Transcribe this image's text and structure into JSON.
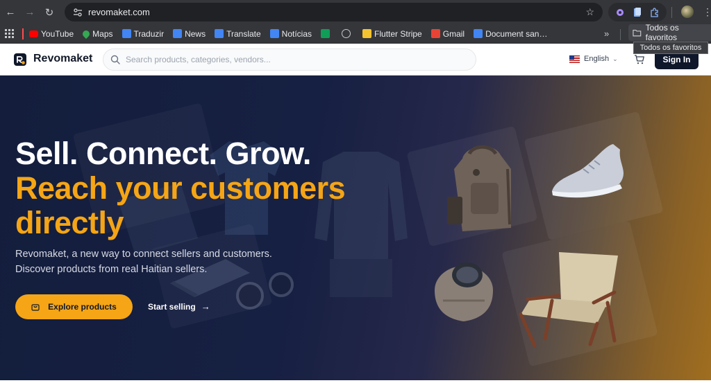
{
  "browser": {
    "url": "revomaket.com",
    "bookmarks": [
      {
        "label": "YouTube",
        "icon": "youtube-icon",
        "color": "#ff0000"
      },
      {
        "label": "Maps",
        "icon": "maps-pin-icon",
        "color": "#34a853"
      },
      {
        "label": "Traduzir",
        "icon": "google-translate-icon",
        "color": "#4285f4"
      },
      {
        "label": "News",
        "icon": "google-news-icon",
        "color": "#4285f4"
      },
      {
        "label": "Translate",
        "icon": "google-translate-icon",
        "color": "#4285f4"
      },
      {
        "label": "Notícias",
        "icon": "google-news-icon",
        "color": "#4285f4"
      },
      {
        "label": "",
        "icon": "green-app-icon",
        "color": "#0f9d58"
      },
      {
        "label": "",
        "icon": "globe-icon",
        "color": "#c7c9cc"
      },
      {
        "label": "Flutter Stripe",
        "icon": "d-logo-icon",
        "color": "#f4c430"
      },
      {
        "label": "Gmail",
        "icon": "gmail-icon",
        "color": "#ea4335"
      },
      {
        "label": "Document san…",
        "icon": "google-docs-icon",
        "color": "#4285f4"
      }
    ],
    "more_label": "»",
    "folder_label": "Todos os favoritos",
    "tooltip": "Todos os favoritos"
  },
  "site": {
    "brand": "Revomaket",
    "search_placeholder": "Search products, categories, vendors...",
    "language": "English",
    "sign_in": "Sign In",
    "colors": {
      "accent": "#f5a515",
      "navy": "#0f172a",
      "hero_bg": "#162042"
    }
  },
  "hero": {
    "headline": "Sell. Connect. Grow.",
    "headline_accent": "Reach your customers directly",
    "sub_line1": "Revomaket, a new way to connect sellers and customers.",
    "sub_line2": "Discover products from real Haitian sellers.",
    "explore_label": "Explore products",
    "start_label": "Start selling",
    "products": [
      "backpack",
      "sneaker",
      "smartwatch",
      "armchair",
      "sweater",
      "denim-shirt",
      "laptop",
      "headphones"
    ]
  }
}
